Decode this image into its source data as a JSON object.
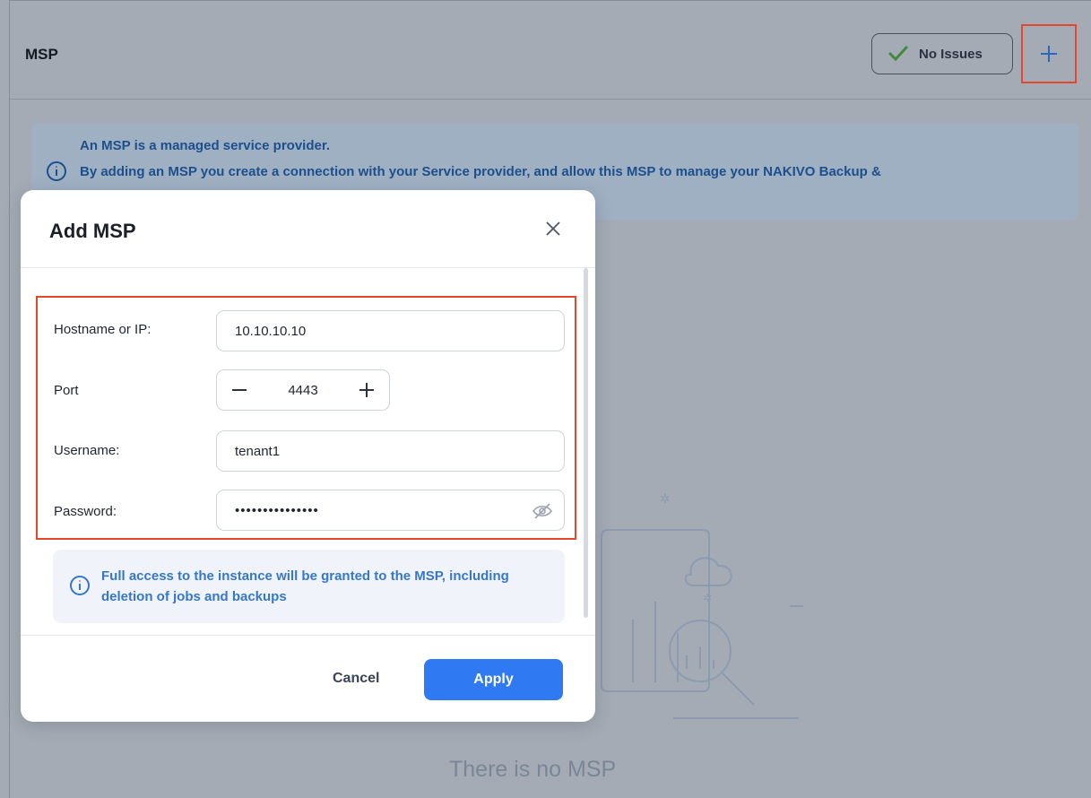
{
  "header": {
    "title": "MSP",
    "status_label": "No Issues"
  },
  "info_banner": {
    "line1": "An MSP is a managed service provider.",
    "line2": "By adding an MSP you create a connection with your Service provider, and allow this MSP to manage your NAKIVO Backup &"
  },
  "empty_state": {
    "message": "There is no MSP"
  },
  "modal": {
    "title": "Add MSP",
    "fields": {
      "hostname_label": "Hostname or IP:",
      "hostname_value": "10.10.10.10",
      "port_label": "Port",
      "port_value": "4443",
      "username_label": "Username:",
      "username_value": "tenant1",
      "password_label": "Password:",
      "password_value": "•••••••••••••••"
    },
    "notice": "Full access to the instance will be granted to the MSP, including deletion of jobs and backups",
    "cancel_label": "Cancel",
    "apply_label": "Apply"
  },
  "colors": {
    "accent": "#2f7af2",
    "highlight_border": "#e5472d",
    "success": "#3f8b3a",
    "info_text": "#3577c9"
  }
}
